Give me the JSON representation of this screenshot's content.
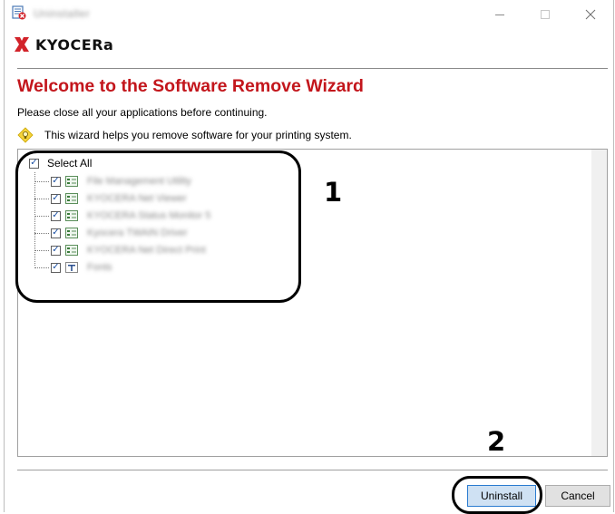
{
  "window": {
    "title": "Uninstaller",
    "controls": {
      "minimize": "—",
      "maximize": "□",
      "close": "✕"
    }
  },
  "brand": {
    "logo_text": "KYOCERa",
    "logo_color": "#d2232a"
  },
  "wizard": {
    "title": "Welcome to the Software Remove Wizard",
    "instruction": "Please close all your applications before continuing.",
    "info": "This wizard helps you remove software for your printing system."
  },
  "tree": {
    "select_all": {
      "label": "Select All",
      "checked": true
    },
    "items": [
      {
        "label": "File Management Utility",
        "checked": true,
        "icon": "app-icon"
      },
      {
        "label": "KYOCERA Net Viewer",
        "checked": true,
        "icon": "app-icon"
      },
      {
        "label": "KYOCERA Status Monitor 5",
        "checked": true,
        "icon": "app-icon"
      },
      {
        "label": "Kyocera TWAIN Driver",
        "checked": true,
        "icon": "app-icon"
      },
      {
        "label": "KYOCERA Net Direct Print",
        "checked": true,
        "icon": "app-icon"
      },
      {
        "label": "Fonts",
        "checked": true,
        "icon": "font-icon"
      }
    ]
  },
  "callouts": {
    "one": "1",
    "two": "2"
  },
  "buttons": {
    "uninstall": "Uninstall",
    "cancel": "Cancel"
  },
  "colors": {
    "title_red": "#c3161c",
    "primary_button": "#cfe1f3",
    "primary_border": "#2a7bd0"
  }
}
